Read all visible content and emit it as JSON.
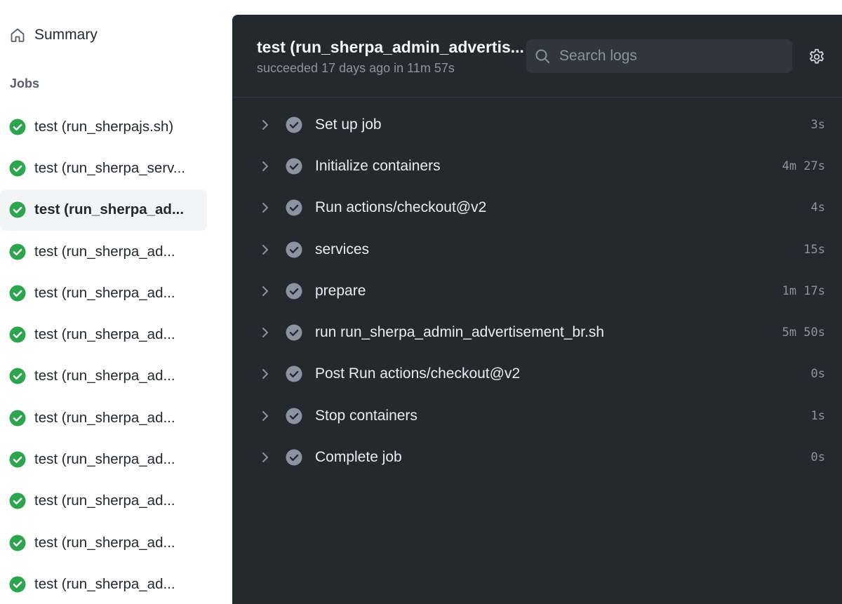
{
  "sidebar": {
    "summary_label": "Summary",
    "jobs_heading": "Jobs",
    "jobs": [
      {
        "label": "test (run_sherpajs.sh)",
        "status": "success",
        "active": false
      },
      {
        "label": "test (run_sherpa_serv...",
        "status": "success",
        "active": false
      },
      {
        "label": "test (run_sherpa_ad...",
        "status": "success",
        "active": true
      },
      {
        "label": "test (run_sherpa_ad...",
        "status": "success",
        "active": false
      },
      {
        "label": "test (run_sherpa_ad...",
        "status": "success",
        "active": false
      },
      {
        "label": "test (run_sherpa_ad...",
        "status": "success",
        "active": false
      },
      {
        "label": "test (run_sherpa_ad...",
        "status": "success",
        "active": false
      },
      {
        "label": "test (run_sherpa_ad...",
        "status": "success",
        "active": false
      },
      {
        "label": "test (run_sherpa_ad...",
        "status": "success",
        "active": false
      },
      {
        "label": "test (run_sherpa_ad...",
        "status": "success",
        "active": false
      },
      {
        "label": "test (run_sherpa_ad...",
        "status": "success",
        "active": false
      },
      {
        "label": "test (run_sherpa_ad...",
        "status": "success",
        "active": false
      }
    ]
  },
  "panel": {
    "title": "test (run_sherpa_admin_advertis...",
    "status_text": "succeeded 17 days ago in 11m 57s",
    "search_placeholder": "Search logs",
    "steps": [
      {
        "name": "Set up job",
        "duration": "3s"
      },
      {
        "name": "Initialize containers",
        "duration": "4m 27s"
      },
      {
        "name": "Run actions/checkout@v2",
        "duration": "4s"
      },
      {
        "name": "services",
        "duration": "15s"
      },
      {
        "name": "prepare",
        "duration": "1m 17s"
      },
      {
        "name": "run run_sherpa_admin_advertisement_br.sh",
        "duration": "5m 50s"
      },
      {
        "name": "Post Run actions/checkout@v2",
        "duration": "0s"
      },
      {
        "name": "Stop containers",
        "duration": "1s"
      },
      {
        "name": "Complete job",
        "duration": "0s"
      }
    ]
  },
  "colors": {
    "success_green": "#2da44e",
    "panel_bg": "#24292f",
    "step_check_gray": "#8b949e"
  },
  "icons": {
    "summary": "home-icon",
    "job_status": "check-circle-icon",
    "search": "search-icon",
    "settings": "gear-icon",
    "expand": "chevron-right-icon"
  }
}
